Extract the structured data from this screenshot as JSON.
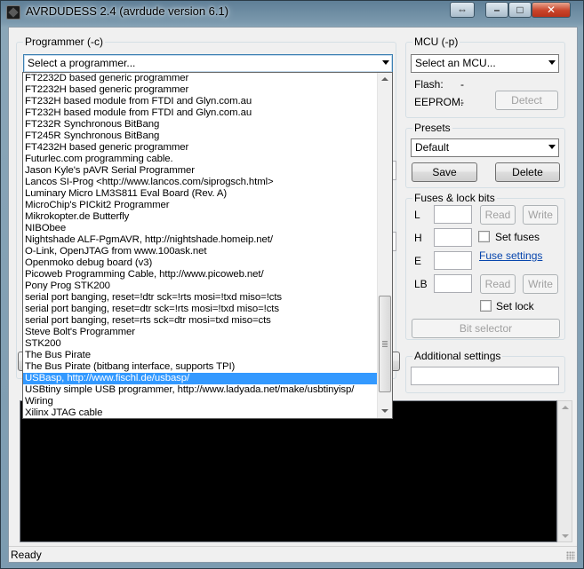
{
  "window": {
    "title": "AVRDUDESS 2.4 (avrdude version 6.1)",
    "close_glyph": "✕",
    "max_glyph": "□",
    "min_glyph": "–",
    "resize_glyph": "⇔"
  },
  "programmer": {
    "label": "Programmer (-c)",
    "value": "Select a programmer...",
    "options": [
      "FT2232D based generic programmer",
      "FT2232H based generic programmer",
      "FT232H based module from FTDI and Glyn.com.au",
      "FT232H based module from FTDI and Glyn.com.au",
      "FT232R Synchronous BitBang",
      "FT245R Synchronous BitBang",
      "FT4232H based generic programmer",
      "Futurlec.com programming cable.",
      "Jason Kyle's pAVR Serial Programmer",
      "Lancos SI-Prog <http://www.lancos.com/siprogsch.html>",
      "Luminary Micro LM3S811 Eval Board (Rev. A)",
      "MicroChip's PICkit2 Programmer",
      "Mikrokopter.de Butterfly",
      "NIBObee",
      "Nightshade ALF-PgmAVR, http://nightshade.homeip.net/",
      "O-Link, OpenJTAG from www.100ask.net",
      "Openmoko debug board (v3)",
      "Picoweb Programming Cable, http://www.picoweb.net/",
      "Pony Prog STK200",
      "serial port banging, reset=!dtr sck=!rts mosi=!txd miso=!cts",
      "serial port banging, reset=dtr sck=!rts mosi=!txd miso=!cts",
      "serial port banging, reset=rts sck=dtr mosi=txd miso=cts",
      "Steve Bolt's Programmer",
      "STK200",
      "The Bus Pirate",
      "The Bus Pirate (bitbang interface, supports TPI)",
      "USBasp, http://www.fischl.de/usbasp/",
      "USBtiny simple USB programmer, http://www.ladyada.net/make/usbtinyisp/",
      "Wiring",
      "Xilinx JTAG cable"
    ],
    "highlighted_index": 26
  },
  "mcu": {
    "label": "MCU (-p)",
    "value": "Select an MCU...",
    "flash_label": "Flash:",
    "flash_value": "-",
    "eeprom_label": "EEPROM:",
    "eeprom_value": "-",
    "detect_label": "Detect"
  },
  "presets": {
    "label": "Presets",
    "value": "Default",
    "save_label": "Save",
    "delete_label": "Delete"
  },
  "fuses": {
    "label": "Fuses & lock bits",
    "l_label": "L",
    "h_label": "H",
    "e_label": "E",
    "lb_label": "LB",
    "read_label": "Read",
    "write_label": "Write",
    "set_fuses_label": "Set fuses",
    "fuse_settings_link": "Fuse settings",
    "set_lock_label": "Set lock",
    "bit_selector_label": "Bit selector"
  },
  "additional": {
    "label": "Additional settings"
  },
  "status": {
    "text": "Ready"
  }
}
